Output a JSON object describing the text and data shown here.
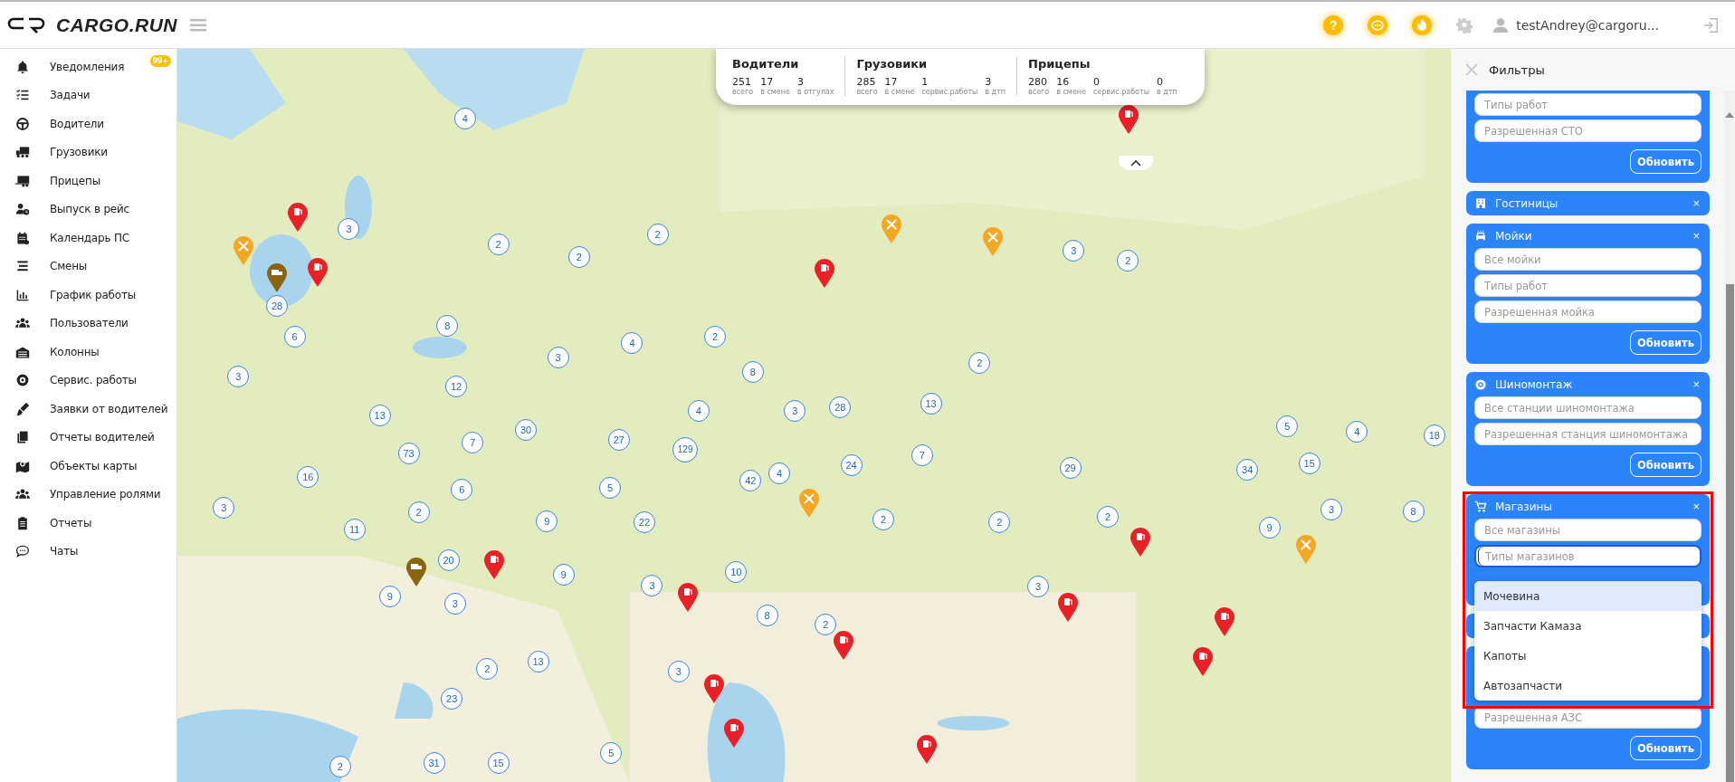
{
  "header": {
    "logo": "CARGO.RUN",
    "help": "?",
    "user": "testAndrey@cargoru..."
  },
  "sidebar": {
    "items": [
      {
        "label": "Уведомления",
        "badge": "99+"
      },
      {
        "label": "Задачи"
      },
      {
        "label": "Водители"
      },
      {
        "label": "Грузовики"
      },
      {
        "label": "Прицепы"
      },
      {
        "label": "Выпуск в рейс"
      },
      {
        "label": "Календарь ПС"
      },
      {
        "label": "Смены"
      },
      {
        "label": "График работы"
      },
      {
        "label": "Пользователи"
      },
      {
        "label": "Колонны"
      },
      {
        "label": "Сервис. работы"
      },
      {
        "label": "Заявки от водителей"
      },
      {
        "label": "Отчеты водителей"
      },
      {
        "label": "Объекты карты"
      },
      {
        "label": "Управление ролями"
      },
      {
        "label": "Отчеты"
      },
      {
        "label": "Чаты"
      }
    ]
  },
  "stats": [
    {
      "title": "Водители",
      "figures": [
        {
          "value": "251",
          "caption": "всего"
        },
        {
          "value": "17",
          "caption": "в смене"
        },
        {
          "value": "3",
          "caption": "в отгулах"
        }
      ]
    },
    {
      "title": "Грузовики",
      "figures": [
        {
          "value": "285",
          "caption": "всего"
        },
        {
          "value": "17",
          "caption": "в смене"
        },
        {
          "value": "1",
          "caption": "сервис.работы"
        },
        {
          "value": "3",
          "caption": "в дтп"
        }
      ]
    },
    {
      "title": "Прицепы",
      "figures": [
        {
          "value": "280",
          "caption": "всего"
        },
        {
          "value": "16",
          "caption": "в смене"
        },
        {
          "value": "0",
          "caption": "сервис.работы"
        },
        {
          "value": "0",
          "caption": "в дтп"
        }
      ]
    }
  ],
  "map": {
    "clusters": [
      {
        "count": "4"
      },
      {
        "count": "3"
      },
      {
        "count": "2"
      },
      {
        "count": "2"
      },
      {
        "count": "2"
      },
      {
        "count": "28"
      },
      {
        "count": "6"
      },
      {
        "count": "8"
      },
      {
        "count": "3"
      },
      {
        "count": "3"
      },
      {
        "count": "4"
      },
      {
        "count": "2"
      },
      {
        "count": "8"
      },
      {
        "count": "12"
      },
      {
        "count": "13"
      },
      {
        "count": "30"
      },
      {
        "count": "27"
      },
      {
        "count": "4"
      },
      {
        "count": "3"
      },
      {
        "count": "28"
      },
      {
        "count": "13"
      },
      {
        "count": "2"
      },
      {
        "count": "3"
      },
      {
        "count": "2"
      },
      {
        "count": "7"
      },
      {
        "count": "73"
      },
      {
        "count": "129"
      },
      {
        "count": "16"
      },
      {
        "count": "6"
      },
      {
        "count": "42"
      },
      {
        "count": "4"
      },
      {
        "count": "24"
      },
      {
        "count": "7"
      },
      {
        "count": "29"
      },
      {
        "count": "5"
      },
      {
        "count": "4"
      },
      {
        "count": "18"
      },
      {
        "count": "34"
      },
      {
        "count": "15"
      },
      {
        "count": "5"
      },
      {
        "count": "3"
      },
      {
        "count": "2"
      },
      {
        "count": "9"
      },
      {
        "count": "22"
      },
      {
        "count": "2"
      },
      {
        "count": "2"
      },
      {
        "count": "2"
      },
      {
        "count": "9"
      },
      {
        "count": "3"
      },
      {
        "count": "8"
      },
      {
        "count": "11"
      },
      {
        "count": "20"
      },
      {
        "count": "9"
      },
      {
        "count": "10"
      },
      {
        "count": "3"
      },
      {
        "count": "3"
      },
      {
        "count": "9"
      },
      {
        "count": "3"
      },
      {
        "count": "8"
      },
      {
        "count": "2"
      },
      {
        "count": "2"
      },
      {
        "count": "13"
      },
      {
        "count": "3"
      },
      {
        "count": "23"
      },
      {
        "count": "5"
      },
      {
        "count": "2"
      },
      {
        "count": "31"
      },
      {
        "count": "15"
      }
    ],
    "pins": [
      {
        "kind": "fuel"
      },
      {
        "kind": "fuel"
      },
      {
        "kind": "fuel"
      },
      {
        "kind": "fuel"
      },
      {
        "kind": "fuel"
      },
      {
        "kind": "fuel"
      },
      {
        "kind": "fuel"
      },
      {
        "kind": "fuel"
      },
      {
        "kind": "fuel"
      },
      {
        "kind": "fuel"
      },
      {
        "kind": "fuel"
      },
      {
        "kind": "fuel"
      },
      {
        "kind": "fuel"
      },
      {
        "kind": "fuel"
      },
      {
        "kind": "service"
      },
      {
        "kind": "service"
      },
      {
        "kind": "service"
      },
      {
        "kind": "service"
      },
      {
        "kind": "service"
      },
      {
        "kind": "truck"
      },
      {
        "kind": "truck"
      }
    ]
  },
  "filters": {
    "title": "Фильтры",
    "cards": [
      {
        "expanded": true,
        "fields": [
          {
            "placeholder": "Типы работ"
          },
          {
            "placeholder": "Разрешенная СТО"
          }
        ],
        "button": "Обновить"
      },
      {
        "title": "Гостиницы",
        "expanded": false,
        "close": "×"
      },
      {
        "title": "Мойки",
        "expanded": true,
        "close": "×",
        "fields": [
          {
            "placeholder": "Все мойки"
          },
          {
            "placeholder": "Типы работ"
          },
          {
            "placeholder": "Разрешенная мойка"
          }
        ],
        "button": "Обновить"
      },
      {
        "title": "Шиномонтаж",
        "expanded": true,
        "close": "×",
        "fields": [
          {
            "placeholder": "Все станции шиномонтажа"
          },
          {
            "placeholder": "Разрешенная станция шиномонтажа"
          }
        ],
        "button": "Обновить"
      },
      {
        "title": "Магазины",
        "expanded": true,
        "highlighted": true,
        "close": "×",
        "fields": [
          {
            "placeholder": "Все магазины",
            "focused": false
          },
          {
            "placeholder": "Типы магазинов",
            "focused": true
          }
        ],
        "dropdown": [
          {
            "label": "Мочевина",
            "selected": true
          },
          {
            "label": "Запчасти Камаза",
            "selected": false
          },
          {
            "label": "Капоты",
            "selected": false
          },
          {
            "label": "Автозапчасти",
            "selected": false
          }
        ]
      },
      {
        "expanded": false
      },
      {
        "expanded": true,
        "fields": [
          {
            "placeholder": "Разрешенная АЗС"
          }
        ],
        "button": "Обновить"
      }
    ]
  }
}
